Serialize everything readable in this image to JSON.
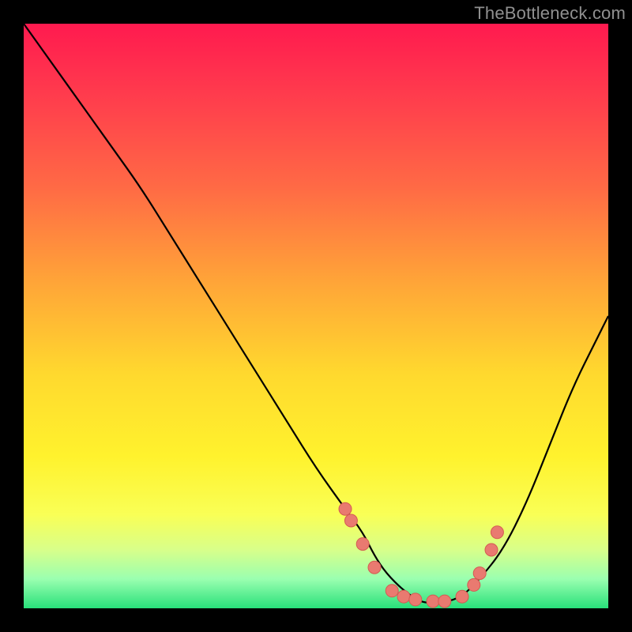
{
  "watermark": {
    "text": "TheBottleneck.com"
  },
  "colors": {
    "curve": "#000000",
    "marker_fill": "#e97a70",
    "marker_stroke": "#d45b52"
  },
  "chart_data": {
    "type": "line",
    "title": "",
    "xlabel": "",
    "ylabel": "",
    "xlim": [
      0,
      100
    ],
    "ylim": [
      0,
      100
    ],
    "grid": false,
    "legend": false,
    "series": [
      {
        "name": "curve",
        "x": [
          0,
          5,
          10,
          15,
          20,
          25,
          30,
          35,
          40,
          45,
          50,
          55,
          58,
          60,
          62,
          65,
          68,
          70,
          72,
          75,
          78,
          82,
          86,
          90,
          94,
          98,
          100
        ],
        "y": [
          100,
          93,
          86,
          79,
          72,
          64,
          56,
          48,
          40,
          32,
          24,
          17,
          13,
          9,
          6,
          3,
          1,
          1,
          1,
          2,
          5,
          10,
          18,
          28,
          38,
          46,
          50
        ]
      }
    ],
    "markers": {
      "name": "points",
      "x": [
        55,
        56,
        58,
        60,
        63,
        65,
        67,
        70,
        72,
        75,
        77,
        78,
        80,
        81
      ],
      "y": [
        17,
        15,
        11,
        7,
        3,
        2,
        1.5,
        1.2,
        1.2,
        2,
        4,
        6,
        10,
        13
      ]
    }
  }
}
